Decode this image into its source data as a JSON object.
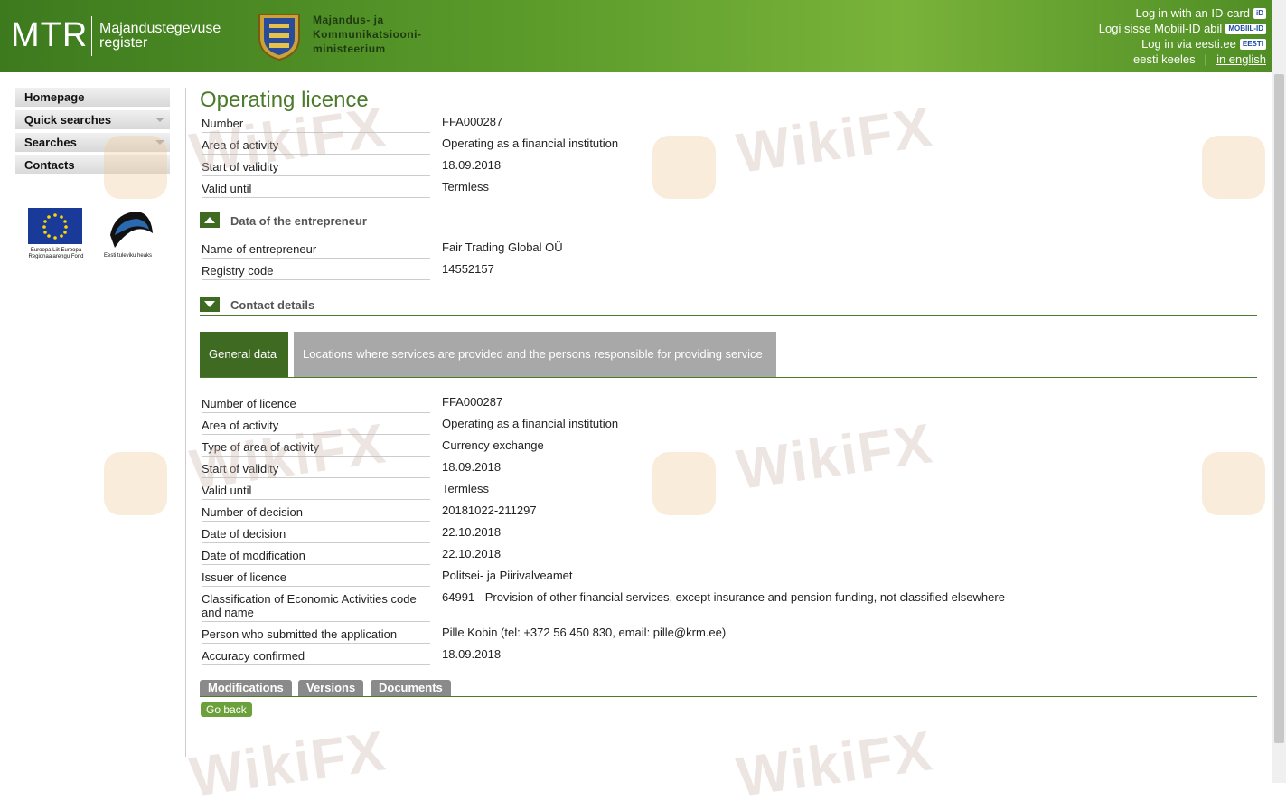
{
  "header": {
    "logo": "MTR",
    "logo_sub_line1": "Majandustegevuse",
    "logo_sub_line2": "register",
    "ministry_line1": "Majandus- ja",
    "ministry_line2": "Kommunikatsiooni-",
    "ministry_line3": "ministeerium",
    "login_id_card": "Log in with an ID-card",
    "login_mobile": "Logi sisse Mobiil-ID abil",
    "login_eesti": "Log in via eesti.ee",
    "badge_id": "iD",
    "badge_mobile": "MOBIIL-ID",
    "badge_eesti": "EESTI",
    "lang_et": "eesti keeles",
    "lang_sep": "|",
    "lang_en": "in english"
  },
  "sidebar": {
    "items": [
      {
        "label": "Homepage"
      },
      {
        "label": "Quick searches"
      },
      {
        "label": "Searches"
      },
      {
        "label": "Contacts"
      }
    ],
    "eu_text": "Euroopa Liit Euroopa Regionaalarengu Fond",
    "ee_text": "Eesti tuleviku heaks"
  },
  "main": {
    "title": "Operating licence",
    "top_fields": [
      {
        "label": "Number",
        "value": "FFA000287"
      },
      {
        "label": "Area of activity",
        "value": "Operating as a financial institution"
      },
      {
        "label": "Start of validity",
        "value": "18.09.2018"
      },
      {
        "label": "Valid until",
        "value": "Termless"
      }
    ],
    "section_entrepreneur": "Data of the entrepreneur",
    "entrepreneur_fields": [
      {
        "label": "Name of entrepreneur",
        "value": "Fair Trading Global OÜ"
      },
      {
        "label": "Registry code",
        "value": "14552157"
      }
    ],
    "section_contact": "Contact details",
    "tabs": {
      "general": "General data",
      "locations": "Locations where services are provided and the persons responsible for providing service"
    },
    "general_fields": [
      {
        "label": "Number of licence",
        "value": "FFA000287"
      },
      {
        "label": "Area of activity",
        "value": "Operating as a financial institution"
      },
      {
        "label": "Type of area of activity",
        "value": "Currency exchange"
      },
      {
        "label": "Start of validity",
        "value": "18.09.2018"
      },
      {
        "label": "Valid until",
        "value": "Termless"
      },
      {
        "label": "Number of decision",
        "value": "20181022-211297"
      },
      {
        "label": "Date of decision",
        "value": "22.10.2018"
      },
      {
        "label": "Date of modification",
        "value": "22.10.2018"
      },
      {
        "label": "Issuer of licence",
        "value": "Politsei- ja Piirivalveamet"
      },
      {
        "label": "Classification of Economic Activities code and name",
        "value": "64991 - Provision of other financial services, except insurance and pension funding, not classified elsewhere"
      },
      {
        "label": "Person who submitted the application",
        "value": "Pille Kobin (tel: +372 56 450 830, email: pille@krm.ee)"
      },
      {
        "label": "Accuracy confirmed",
        "value": "18.09.2018"
      }
    ],
    "bottom_tabs": [
      "Modifications",
      "Versions",
      "Documents"
    ],
    "go_back": "Go back"
  },
  "watermark": "WikiFX",
  "colors": {
    "accent_green": "#3f6a22",
    "title_green": "#4a7a2a",
    "inactive_tab": "#a8a8a8",
    "go_back": "#6ba03a"
  }
}
